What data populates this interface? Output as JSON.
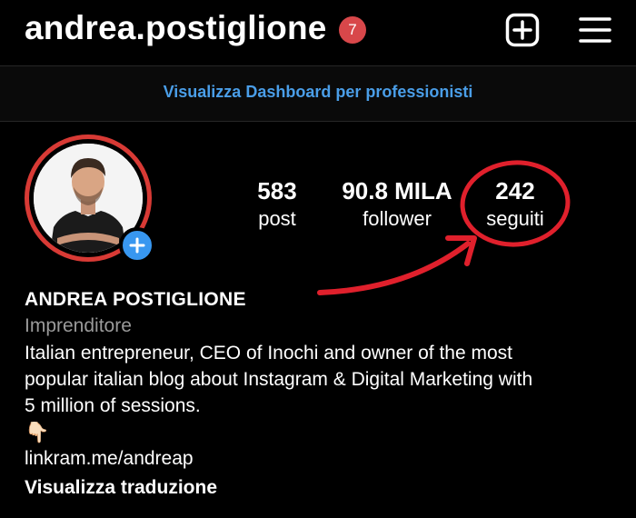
{
  "header": {
    "username": "andrea.postiglione",
    "notification_count": "7"
  },
  "dashboard": {
    "label": "Visualizza Dashboard per professionisti"
  },
  "stats": {
    "posts": {
      "value": "583",
      "label": "post"
    },
    "followers": {
      "value": "90.8 MILA",
      "label": "follower"
    },
    "following": {
      "value": "242",
      "label": "seguiti"
    }
  },
  "bio": {
    "full_name": "ANDREA POSTIGLIONE",
    "category": "Imprenditore",
    "lines": [
      "Italian entrepreneur, CEO of Inochi and owner of the most",
      "popular italian blog about Instagram & Digital Marketing with",
      "5 million of sessions."
    ],
    "emoji": "👇🏻",
    "link": "linkram.me/andreap",
    "translate": "Visualizza traduzione"
  },
  "colors": {
    "background": "#000000",
    "accent_link": "#4a9ee8",
    "badge": "#d8474a",
    "story_ring": "#d83a35",
    "annotation": "#e0202c",
    "add_story": "#3897f0"
  },
  "icons": {
    "new_post": "plus-square-icon",
    "menu": "hamburger-menu-icon",
    "add_story": "plus-icon"
  }
}
